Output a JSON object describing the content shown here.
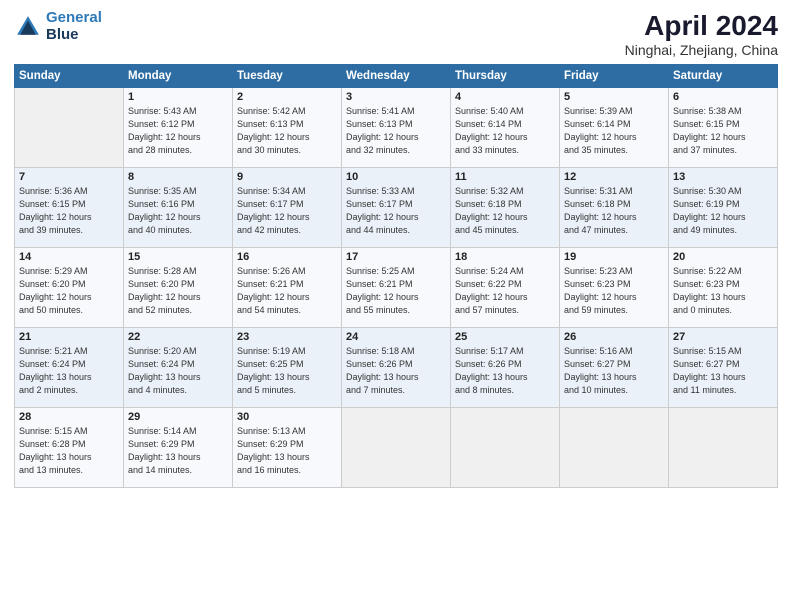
{
  "header": {
    "logo_line1": "General",
    "logo_line2": "Blue",
    "title": "April 2024",
    "location": "Ninghai, Zhejiang, China"
  },
  "days_of_week": [
    "Sunday",
    "Monday",
    "Tuesday",
    "Wednesday",
    "Thursday",
    "Friday",
    "Saturday"
  ],
  "weeks": [
    [
      {
        "day": "",
        "info": ""
      },
      {
        "day": "1",
        "info": "Sunrise: 5:43 AM\nSunset: 6:12 PM\nDaylight: 12 hours\nand 28 minutes."
      },
      {
        "day": "2",
        "info": "Sunrise: 5:42 AM\nSunset: 6:13 PM\nDaylight: 12 hours\nand 30 minutes."
      },
      {
        "day": "3",
        "info": "Sunrise: 5:41 AM\nSunset: 6:13 PM\nDaylight: 12 hours\nand 32 minutes."
      },
      {
        "day": "4",
        "info": "Sunrise: 5:40 AM\nSunset: 6:14 PM\nDaylight: 12 hours\nand 33 minutes."
      },
      {
        "day": "5",
        "info": "Sunrise: 5:39 AM\nSunset: 6:14 PM\nDaylight: 12 hours\nand 35 minutes."
      },
      {
        "day": "6",
        "info": "Sunrise: 5:38 AM\nSunset: 6:15 PM\nDaylight: 12 hours\nand 37 minutes."
      }
    ],
    [
      {
        "day": "7",
        "info": "Sunrise: 5:36 AM\nSunset: 6:15 PM\nDaylight: 12 hours\nand 39 minutes."
      },
      {
        "day": "8",
        "info": "Sunrise: 5:35 AM\nSunset: 6:16 PM\nDaylight: 12 hours\nand 40 minutes."
      },
      {
        "day": "9",
        "info": "Sunrise: 5:34 AM\nSunset: 6:17 PM\nDaylight: 12 hours\nand 42 minutes."
      },
      {
        "day": "10",
        "info": "Sunrise: 5:33 AM\nSunset: 6:17 PM\nDaylight: 12 hours\nand 44 minutes."
      },
      {
        "day": "11",
        "info": "Sunrise: 5:32 AM\nSunset: 6:18 PM\nDaylight: 12 hours\nand 45 minutes."
      },
      {
        "day": "12",
        "info": "Sunrise: 5:31 AM\nSunset: 6:18 PM\nDaylight: 12 hours\nand 47 minutes."
      },
      {
        "day": "13",
        "info": "Sunrise: 5:30 AM\nSunset: 6:19 PM\nDaylight: 12 hours\nand 49 minutes."
      }
    ],
    [
      {
        "day": "14",
        "info": "Sunrise: 5:29 AM\nSunset: 6:20 PM\nDaylight: 12 hours\nand 50 minutes."
      },
      {
        "day": "15",
        "info": "Sunrise: 5:28 AM\nSunset: 6:20 PM\nDaylight: 12 hours\nand 52 minutes."
      },
      {
        "day": "16",
        "info": "Sunrise: 5:26 AM\nSunset: 6:21 PM\nDaylight: 12 hours\nand 54 minutes."
      },
      {
        "day": "17",
        "info": "Sunrise: 5:25 AM\nSunset: 6:21 PM\nDaylight: 12 hours\nand 55 minutes."
      },
      {
        "day": "18",
        "info": "Sunrise: 5:24 AM\nSunset: 6:22 PM\nDaylight: 12 hours\nand 57 minutes."
      },
      {
        "day": "19",
        "info": "Sunrise: 5:23 AM\nSunset: 6:23 PM\nDaylight: 12 hours\nand 59 minutes."
      },
      {
        "day": "20",
        "info": "Sunrise: 5:22 AM\nSunset: 6:23 PM\nDaylight: 13 hours\nand 0 minutes."
      }
    ],
    [
      {
        "day": "21",
        "info": "Sunrise: 5:21 AM\nSunset: 6:24 PM\nDaylight: 13 hours\nand 2 minutes."
      },
      {
        "day": "22",
        "info": "Sunrise: 5:20 AM\nSunset: 6:24 PM\nDaylight: 13 hours\nand 4 minutes."
      },
      {
        "day": "23",
        "info": "Sunrise: 5:19 AM\nSunset: 6:25 PM\nDaylight: 13 hours\nand 5 minutes."
      },
      {
        "day": "24",
        "info": "Sunrise: 5:18 AM\nSunset: 6:26 PM\nDaylight: 13 hours\nand 7 minutes."
      },
      {
        "day": "25",
        "info": "Sunrise: 5:17 AM\nSunset: 6:26 PM\nDaylight: 13 hours\nand 8 minutes."
      },
      {
        "day": "26",
        "info": "Sunrise: 5:16 AM\nSunset: 6:27 PM\nDaylight: 13 hours\nand 10 minutes."
      },
      {
        "day": "27",
        "info": "Sunrise: 5:15 AM\nSunset: 6:27 PM\nDaylight: 13 hours\nand 11 minutes."
      }
    ],
    [
      {
        "day": "28",
        "info": "Sunrise: 5:15 AM\nSunset: 6:28 PM\nDaylight: 13 hours\nand 13 minutes."
      },
      {
        "day": "29",
        "info": "Sunrise: 5:14 AM\nSunset: 6:29 PM\nDaylight: 13 hours\nand 14 minutes."
      },
      {
        "day": "30",
        "info": "Sunrise: 5:13 AM\nSunset: 6:29 PM\nDaylight: 13 hours\nand 16 minutes."
      },
      {
        "day": "",
        "info": ""
      },
      {
        "day": "",
        "info": ""
      },
      {
        "day": "",
        "info": ""
      },
      {
        "day": "",
        "info": ""
      }
    ]
  ]
}
